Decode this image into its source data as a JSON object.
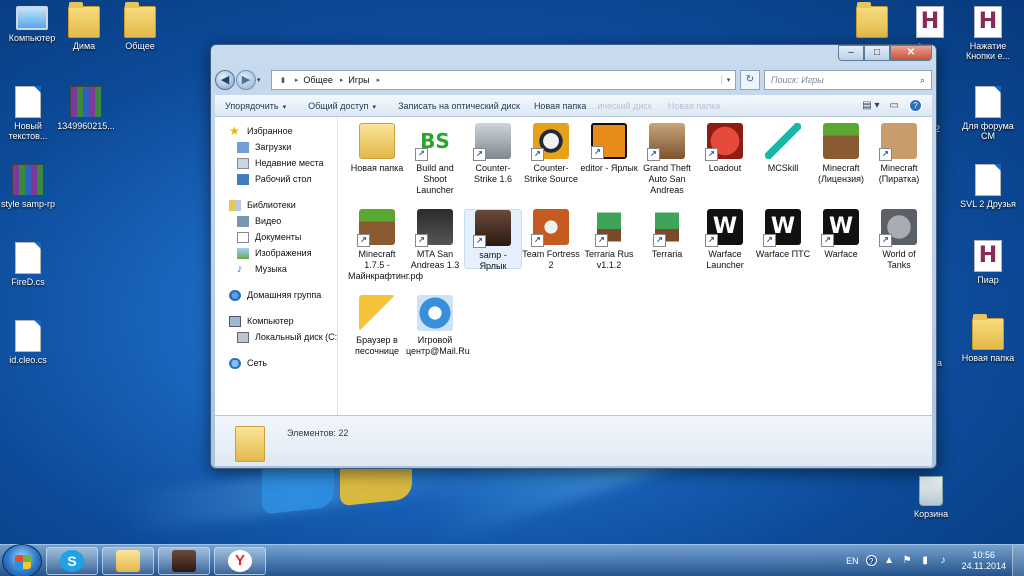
{
  "desktop": {
    "left_icons": [
      {
        "label": "Компьютер",
        "icon": "computer-icon"
      },
      {
        "label": "Дима",
        "icon": "folder-icon"
      },
      {
        "label": "Общее",
        "icon": "folder-icon"
      },
      {
        "label": "Новый текстов...",
        "icon": "text-document-icon"
      },
      {
        "label": "1349960215...",
        "icon": "winrar-archive-icon"
      },
      {
        "label": "style samp-rp",
        "icon": "winrar-archive-icon"
      },
      {
        "label": "FireD.cs",
        "icon": "script-file-icon"
      },
      {
        "label": "id.cleo.cs",
        "icon": "script-file-icon"
      }
    ],
    "right_icons": [
      {
        "label": "",
        "icon": "folder-icon"
      },
      {
        "label": "",
        "icon": "h-document-icon"
      },
      {
        "label": "Нажатие Кнопки е...",
        "icon": "h-document-icon"
      },
      {
        "label": "Для форума СМ",
        "icon": "text-document-icon"
      },
      {
        "label": "SVL 2 Друзья",
        "icon": "text-document-icon"
      },
      {
        "label": "Пиар",
        "icon": "h-document-icon"
      },
      {
        "label": "Новая папка",
        "icon": "folder-icon"
      },
      {
        "label": "Корзина",
        "icon": "recycle-bin-icon"
      }
    ],
    "partial_labels": {
      "right_edge_top": "-2",
      "right_edge_mid": "-2",
      "right_edge_bottom": "ра"
    }
  },
  "window": {
    "caption": {
      "minimize": "–",
      "maximize": "□",
      "close": "✕"
    },
    "nav": {
      "back": "◀",
      "forward": "▶",
      "dropdown": "▾"
    },
    "address": {
      "crumbs": [
        "Общее",
        "Игры"
      ],
      "separator": "▸",
      "dropdown": "▾",
      "refresh": "↻"
    },
    "search": {
      "placeholder": "Поиск: Игры",
      "icon": "⌕"
    },
    "toolbar": {
      "organize": "Упорядочить",
      "share": "Общий доступ",
      "burn": "Записать на оптический диск",
      "new_folder": "Новая папка",
      "ghost_1": "…ический диск",
      "ghost_2": "Новая папка",
      "arrow": "▾",
      "views": "▤ ▾",
      "preview": "▭",
      "help": "?"
    },
    "navpane": {
      "favorites": {
        "title": "Избранное",
        "items": [
          "Загрузки",
          "Недавние места",
          "Рабочий стол"
        ]
      },
      "libraries": {
        "title": "Библиотеки",
        "items": [
          "Видео",
          "Документы",
          "Изображения",
          "Музыка"
        ]
      },
      "homegroup": "Домашняя группа",
      "computer": {
        "title": "Компьютер",
        "items": [
          "Локальный диск (C:"
        ]
      },
      "network": "Сеть"
    },
    "files": [
      {
        "name": "Новая папка",
        "icon": "folder-icon",
        "shortcut": false
      },
      {
        "name": "Build and Shoot Launcher",
        "icon": "build-and-shoot-icon",
        "shortcut": true
      },
      {
        "name": "Counter-Strike 1.6",
        "icon": "counter-strike-icon",
        "shortcut": true
      },
      {
        "name": "Counter-Strike Source",
        "icon": "counter-strike-source-icon",
        "shortcut": true
      },
      {
        "name": "editor - Ярлык",
        "icon": "editor-icon",
        "shortcut": true
      },
      {
        "name": "Grand Theft Auto San Andreas",
        "icon": "gta-sa-icon",
        "shortcut": true
      },
      {
        "name": "Loadout",
        "icon": "loadout-icon",
        "shortcut": true
      },
      {
        "name": "MCSkill",
        "icon": "pickaxe-icon",
        "shortcut": false
      },
      {
        "name": "Minecraft (Лицензия)",
        "icon": "minecraft-grass-icon",
        "shortcut": false
      },
      {
        "name": "Minecraft (Пиратка)",
        "icon": "minecraft-pirate-icon",
        "shortcut": true
      },
      {
        "name": "Minecraft 1.7.5 - Майнкрафтинг.рф",
        "icon": "minecraft-grass-icon",
        "shortcut": true
      },
      {
        "name": "MTA San Andreas 1.3",
        "icon": "mta-icon",
        "shortcut": true
      },
      {
        "name": "samp - Ярлык",
        "icon": "samp-icon",
        "shortcut": true
      },
      {
        "name": "Team Fortress 2",
        "icon": "team-fortress-icon",
        "shortcut": true
      },
      {
        "name": "Terraria Rus v1.1.2",
        "icon": "terraria-icon",
        "shortcut": true
      },
      {
        "name": "Terraria",
        "icon": "terraria-icon",
        "shortcut": true
      },
      {
        "name": "Warface Launcher",
        "icon": "warface-icon",
        "shortcut": true
      },
      {
        "name": "Warface ПТС",
        "icon": "warface-icon",
        "shortcut": true
      },
      {
        "name": "Warface",
        "icon": "warface-icon",
        "shortcut": true
      },
      {
        "name": "World of Tanks",
        "icon": "world-of-tanks-icon",
        "shortcut": true
      },
      {
        "name": "Браузер в песочнице",
        "icon": "sandbox-browser-icon",
        "shortcut": false
      },
      {
        "name": "Игровой центр@Mail.Ru",
        "icon": "mailru-game-center-icon",
        "shortcut": false
      }
    ],
    "selected_file": "samp - Ярлык",
    "status": {
      "count_text": "Элементов: 22"
    }
  },
  "taskbar": {
    "apps": [
      {
        "name": "skype",
        "glyph": "S",
        "icon": "skype-icon"
      },
      {
        "name": "explorer",
        "glyph": "",
        "icon": "explorer-folder-icon"
      },
      {
        "name": "samp",
        "glyph": "",
        "icon": "samp-icon"
      },
      {
        "name": "yandex",
        "glyph": "Y",
        "icon": "yandex-browser-icon"
      }
    ],
    "tray": {
      "lang": "EN",
      "help": "?",
      "icons": [
        "▲",
        "⚑",
        "▮",
        "♪"
      ],
      "time": "10:56",
      "date": "24.11.2014"
    }
  }
}
